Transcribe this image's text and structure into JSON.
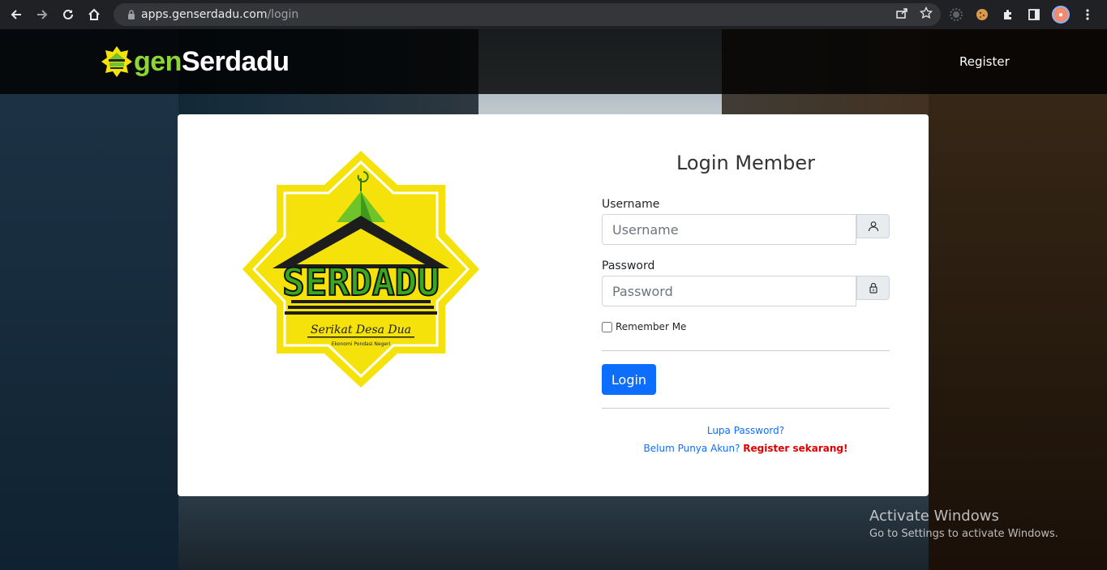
{
  "browser": {
    "url_host": "apps.genserdadu.com",
    "url_path": "/login"
  },
  "navbar": {
    "brand_gen": "gen",
    "brand_serdadu": "Serdadu",
    "register_label": "Register"
  },
  "logo": {
    "wordmark": "SERDADU",
    "tagline": "Serikat Desa Dua",
    "subline": "Ekonomi Pondasi Negeri"
  },
  "login": {
    "title": "Login Member",
    "username_label": "Username",
    "username_placeholder": "Username",
    "password_label": "Password",
    "password_placeholder": "Password",
    "remember_label": "Remember Me",
    "login_button": "Login",
    "forgot_link": "Lupa Password?",
    "no_account_text": "Belum Punya Akun?",
    "register_now": "Register sekarang!"
  },
  "watermark": {
    "title": "Activate Windows",
    "subtitle": "Go to Settings to activate Windows."
  },
  "colors": {
    "brand_green": "#8bd634",
    "primary": "#0d6efd",
    "danger": "#e00000",
    "emblem_yellow": "#f5e20a"
  }
}
